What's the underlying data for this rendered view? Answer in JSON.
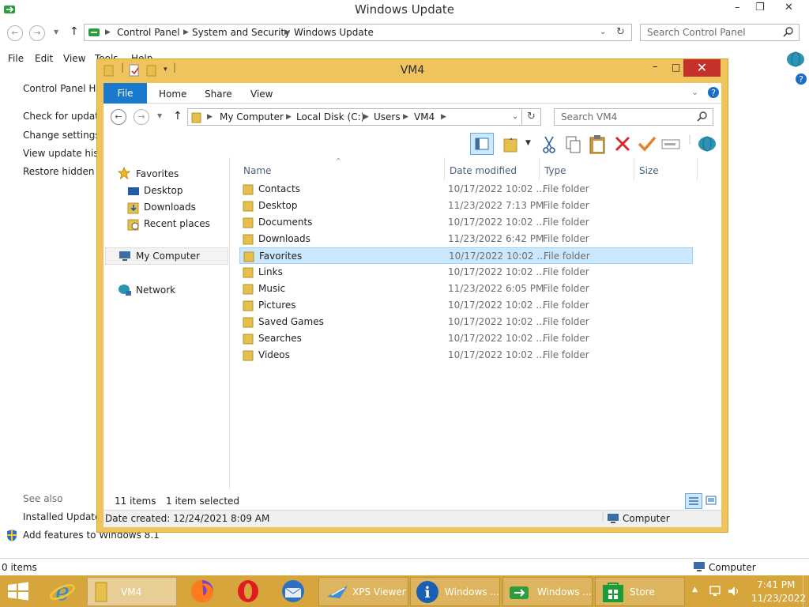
{
  "background_window": {
    "title": "Windows Update",
    "window_controls": {
      "minimize": "–",
      "restore": "❐",
      "close": "✕"
    },
    "address": {
      "breadcrumbs": [
        "Control Panel",
        "System and Security",
        "Windows Update"
      ],
      "search_placeholder": "Search Control Panel"
    },
    "menu": [
      "File",
      "Edit",
      "View",
      "Tools",
      "Help"
    ],
    "sidebar_links": [
      "Control Panel Home",
      "Check for updates",
      "Change settings",
      "View update history",
      "Restore hidden updates"
    ],
    "see_also_label": "See also",
    "see_also_links": [
      "Installed Updates",
      "Add features to Windows 8.1"
    ],
    "status": {
      "items": "0 items",
      "location": "Computer"
    }
  },
  "explorer": {
    "title": "VM4",
    "ribbon_tabs": [
      "File",
      "Home",
      "Share",
      "View"
    ],
    "breadcrumbs": [
      "My Computer",
      "Local Disk (C:)",
      "Users",
      "VM4"
    ],
    "search_placeholder": "Search VM4",
    "nav": {
      "favorites_label": "Favorites",
      "favorites": [
        "Desktop",
        "Downloads",
        "Recent places"
      ],
      "computer_label": "My Computer",
      "network_label": "Network"
    },
    "columns": [
      "Name",
      "Date modified",
      "Type",
      "Size"
    ],
    "files": [
      {
        "name": "Contacts",
        "date": "10/17/2022 10:02 ...",
        "type": "File folder",
        "selected": false
      },
      {
        "name": "Desktop",
        "date": "11/23/2022 7:13 PM",
        "type": "File folder",
        "selected": false
      },
      {
        "name": "Documents",
        "date": "10/17/2022 10:02 ...",
        "type": "File folder",
        "selected": false
      },
      {
        "name": "Downloads",
        "date": "11/23/2022 6:42 PM",
        "type": "File folder",
        "selected": false
      },
      {
        "name": "Favorites",
        "date": "10/17/2022 10:02 ...",
        "type": "File folder",
        "selected": true
      },
      {
        "name": "Links",
        "date": "10/17/2022 10:02 ...",
        "type": "File folder",
        "selected": false
      },
      {
        "name": "Music",
        "date": "11/23/2022 6:05 PM",
        "type": "File folder",
        "selected": false
      },
      {
        "name": "Pictures",
        "date": "10/17/2022 10:02 ...",
        "type": "File folder",
        "selected": false
      },
      {
        "name": "Saved Games",
        "date": "10/17/2022 10:02 ...",
        "type": "File folder",
        "selected": false
      },
      {
        "name": "Searches",
        "date": "10/17/2022 10:02 ...",
        "type": "File folder",
        "selected": false
      },
      {
        "name": "Videos",
        "date": "10/17/2022 10:02 ...",
        "type": "File folder",
        "selected": false
      }
    ],
    "status": {
      "count": "11 items",
      "selected": "1 item selected"
    },
    "details": {
      "date_created": "Date created: 12/24/2021 8:09 AM",
      "location": "Computer"
    }
  },
  "taskbar": {
    "buttons": [
      {
        "label": "VM4",
        "icon": "folder-icon"
      },
      {
        "label": "XPS Viewer",
        "icon": "xps-viewer-icon"
      },
      {
        "label": "Windows ...",
        "icon": "info-icon"
      },
      {
        "label": "Windows ...",
        "icon": "windows-update-icon"
      },
      {
        "label": "Store",
        "icon": "store-icon"
      }
    ],
    "time": "7:41 PM",
    "date": "11/23/2022"
  },
  "colors": {
    "window_frame": "#f0c45c",
    "taskbar": "#d6a53c",
    "file_tab": "#1979ca",
    "selection": "#cce8ff",
    "close_button": "#c7312b"
  }
}
